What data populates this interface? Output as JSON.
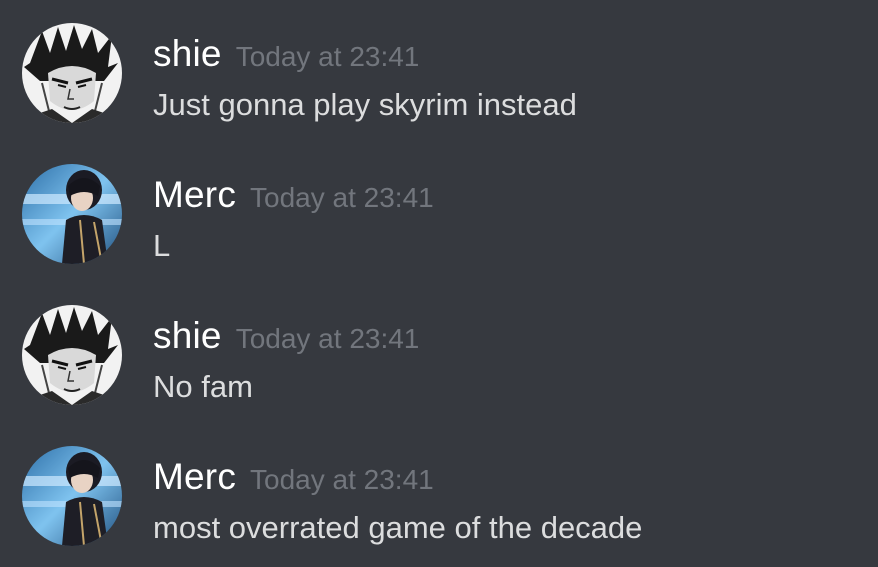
{
  "colors": {
    "background": "#36393f",
    "username": "#ffffff",
    "timestamp": "#72767d",
    "message_text": "#dcddde"
  },
  "messages": [
    {
      "author": "shie",
      "avatar": "manga-character-avatar",
      "timestamp": "Today at 23:41",
      "text": "Just gonna play skyrim instead"
    },
    {
      "author": "Merc",
      "avatar": "anime-character-avatar",
      "timestamp": "Today at 23:41",
      "text": "L"
    },
    {
      "author": "shie",
      "avatar": "manga-character-avatar",
      "timestamp": "Today at 23:41",
      "text": "No fam"
    },
    {
      "author": "Merc",
      "avatar": "anime-character-avatar",
      "timestamp": "Today at 23:41",
      "text": "most overrated game of the decade"
    }
  ]
}
